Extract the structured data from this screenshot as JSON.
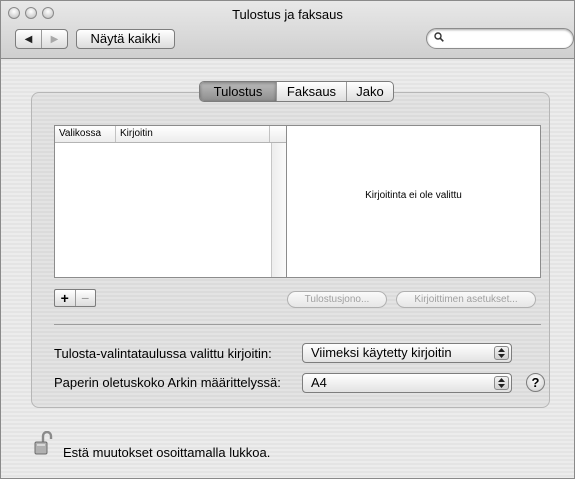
{
  "window": {
    "title": "Tulostus ja faksaus"
  },
  "toolbar": {
    "back_icon": "left-arrow-icon",
    "forward_icon": "right-arrow-icon",
    "show_all_label": "Näytä kaikki",
    "search": {
      "value": "",
      "placeholder": ""
    }
  },
  "tabs": [
    {
      "label": "Tulostus",
      "selected": true
    },
    {
      "label": "Faksaus",
      "selected": false
    },
    {
      "label": "Jako",
      "selected": false
    }
  ],
  "printer_list": {
    "columns": [
      "Valikossa",
      "Kirjoitin"
    ],
    "rows": []
  },
  "detail": {
    "no_selection_text": "Kirjoitinta ei ole valittu"
  },
  "buttons": {
    "add": "+",
    "remove": "−",
    "print_queue": "Tulostusjono...",
    "printer_setup": "Kirjoittimen asetukset..."
  },
  "settings": {
    "selected_printer_label": "Tulosta-valintataulussa valittu kirjoitin:",
    "selected_printer_value": "Viimeksi käytetty kirjoitin",
    "paper_size_label": "Paperin oletuskoko Arkin määrittelyssä:",
    "paper_size_value": "A4"
  },
  "help_label": "?",
  "lock": {
    "text": "Estä muutokset osoittamalla lukkoa.",
    "state": "unlocked"
  }
}
